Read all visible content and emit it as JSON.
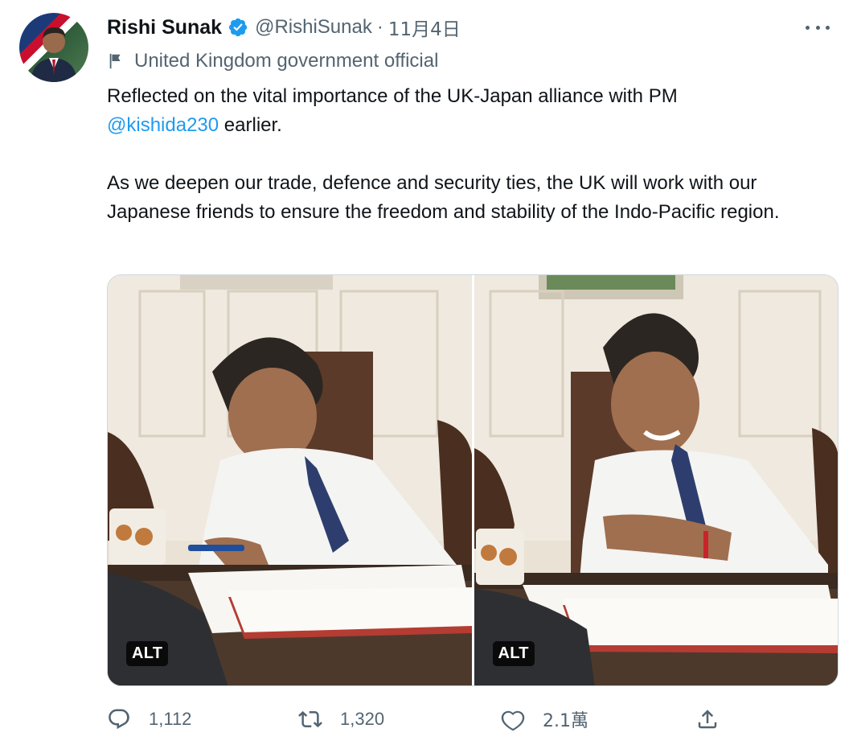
{
  "author": {
    "name": "Rishi Sunak",
    "handle": "@RishiSunak",
    "separator": "·",
    "date": "11月4日",
    "verified": true
  },
  "label": {
    "icon": "flag-icon",
    "text": "United Kingdom government official"
  },
  "tweet": {
    "line1_before": "Reflected on the vital importance of the UK-Japan alliance with PM",
    "mention": "@kishida230",
    "line1_after": " earlier.",
    "paragraph2": "As we deepen our trade, defence and security ties, the UK will work with our Japanese friends to ensure the freedom and stability of the Indo-Pacific region."
  },
  "media": [
    {
      "alt_label": "ALT"
    },
    {
      "alt_label": "ALT"
    }
  ],
  "actions": {
    "replies": "1,112",
    "retweets": "1,320",
    "likes": "2.1萬"
  },
  "colors": {
    "accent": "#1d9bf0",
    "secondary_text": "#536471",
    "primary_text": "#0f1419"
  }
}
